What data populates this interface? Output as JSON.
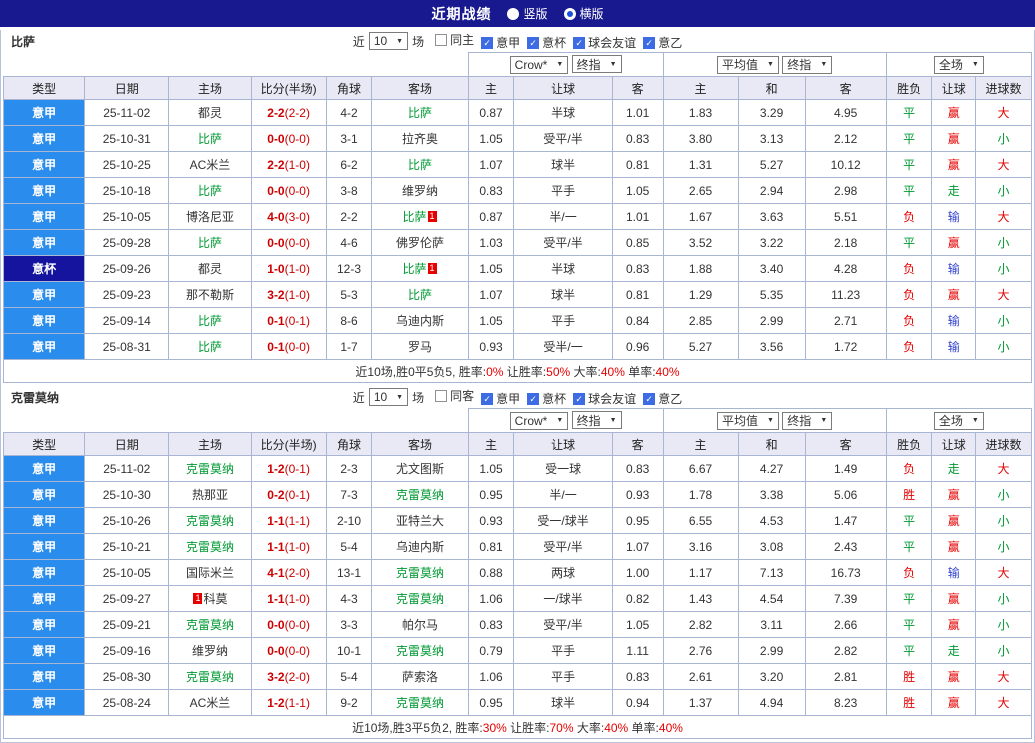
{
  "topbar": {
    "title": "近期战绩",
    "options": [
      {
        "label": "竖版",
        "selected": false
      },
      {
        "label": "横版",
        "selected": true
      }
    ]
  },
  "columns": {
    "type": "类型",
    "date": "日期",
    "home": "主场",
    "score": "比分(半场)",
    "corner": "角球",
    "away": "客场",
    "odds_home": "主",
    "handicap": "让球",
    "odds_away": "客",
    "avg_home": "主",
    "avg_draw": "和",
    "avg_away": "客",
    "result": "胜负",
    "let_result": "让球",
    "goals": "进球数"
  },
  "colors": {
    "accent_blue": "#2a8cec",
    "cup_navy": "#14149e",
    "focus_green": "#009933",
    "score_red": "#cc0000",
    "header_lavender": "#e9e9f6",
    "topbar_navy": "#19198f"
  },
  "value_colors": {
    "胜": "#e60000",
    "平": "#009933",
    "负": "#e60000",
    "赢": "#e60000",
    "走": "#009933",
    "输": "#3344cc",
    "大": "#e60000",
    "小": "#009933"
  },
  "sections": [
    {
      "team": "比萨",
      "filter": {
        "near": "近",
        "count": "10",
        "games": "场",
        "checks": [
          {
            "label": "同主",
            "checked": false
          },
          {
            "label": "意甲",
            "checked": true
          },
          {
            "label": "意杯",
            "checked": true
          },
          {
            "label": "球会友谊",
            "checked": true
          },
          {
            "label": "意乙",
            "checked": true
          }
        ]
      },
      "selects": {
        "odds_source": "Crow*",
        "odds_final": "终指",
        "avg": "平均值",
        "avg_final": "终指",
        "scope": "全场"
      },
      "rows": [
        {
          "league": "意甲",
          "date": "25-11-02",
          "home": "都灵",
          "score": "2-2",
          "half": "(2-2)",
          "corner": "4-2",
          "away": "比萨",
          "o1": "0.87",
          "hc": "半球",
          "o2": "1.01",
          "a1": "1.83",
          "ax": "3.29",
          "a2": "4.95",
          "r": "平",
          "lr": "赢",
          "g": "大"
        },
        {
          "league": "意甲",
          "date": "25-10-31",
          "home": "比萨",
          "score": "0-0",
          "half": "(0-0)",
          "corner": "3-1",
          "away": "拉齐奥",
          "o1": "1.05",
          "hc": "受平/半",
          "o2": "0.83",
          "a1": "3.80",
          "ax": "3.13",
          "a2": "2.12",
          "r": "平",
          "lr": "赢",
          "g": "小"
        },
        {
          "league": "意甲",
          "date": "25-10-25",
          "home": "AC米兰",
          "score": "2-2",
          "half": "(1-0)",
          "corner": "6-2",
          "away": "比萨",
          "o1": "1.07",
          "hc": "球半",
          "o2": "0.81",
          "a1": "1.31",
          "ax": "5.27",
          "a2": "10.12",
          "r": "平",
          "lr": "赢",
          "g": "大"
        },
        {
          "league": "意甲",
          "date": "25-10-18",
          "home": "比萨",
          "score": "0-0",
          "half": "(0-0)",
          "corner": "3-8",
          "away": "维罗纳",
          "o1": "0.83",
          "hc": "平手",
          "o2": "1.05",
          "a1": "2.65",
          "ax": "2.94",
          "a2": "2.98",
          "r": "平",
          "lr": "走",
          "g": "小"
        },
        {
          "league": "意甲",
          "date": "25-10-05",
          "home": "博洛尼亚",
          "score": "4-0",
          "half": "(3-0)",
          "corner": "2-2",
          "away": "比萨",
          "away_card": "1",
          "o1": "0.87",
          "hc": "半/一",
          "o2": "1.01",
          "a1": "1.67",
          "ax": "3.63",
          "a2": "5.51",
          "r": "负",
          "lr": "输",
          "g": "大"
        },
        {
          "league": "意甲",
          "date": "25-09-28",
          "home": "比萨",
          "score": "0-0",
          "half": "(0-0)",
          "corner": "4-6",
          "away": "佛罗伦萨",
          "o1": "1.03",
          "hc": "受平/半",
          "o2": "0.85",
          "a1": "3.52",
          "ax": "3.22",
          "a2": "2.18",
          "r": "平",
          "lr": "赢",
          "g": "小"
        },
        {
          "league": "意杯",
          "date": "25-09-26",
          "home": "都灵",
          "score": "1-0",
          "half": "(1-0)",
          "corner": "12-3",
          "away": "比萨",
          "away_card": "1",
          "o1": "1.05",
          "hc": "半球",
          "o2": "0.83",
          "a1": "1.88",
          "ax": "3.40",
          "a2": "4.28",
          "r": "负",
          "lr": "输",
          "g": "小"
        },
        {
          "league": "意甲",
          "date": "25-09-23",
          "home": "那不勒斯",
          "score": "3-2",
          "half": "(1-0)",
          "corner": "5-3",
          "away": "比萨",
          "o1": "1.07",
          "hc": "球半",
          "o2": "0.81",
          "a1": "1.29",
          "ax": "5.35",
          "a2": "11.23",
          "r": "负",
          "lr": "赢",
          "g": "大"
        },
        {
          "league": "意甲",
          "date": "25-09-14",
          "home": "比萨",
          "score": "0-1",
          "half": "(0-1)",
          "corner": "8-6",
          "away": "乌迪内斯",
          "o1": "1.05",
          "hc": "平手",
          "o2": "0.84",
          "a1": "2.85",
          "ax": "2.99",
          "a2": "2.71",
          "r": "负",
          "lr": "输",
          "g": "小"
        },
        {
          "league": "意甲",
          "date": "25-08-31",
          "home": "比萨",
          "score": "0-1",
          "half": "(0-0)",
          "corner": "1-7",
          "away": "罗马",
          "o1": "0.93",
          "hc": "受半/一",
          "o2": "0.96",
          "a1": "5.27",
          "ax": "3.56",
          "a2": "1.72",
          "r": "负",
          "lr": "输",
          "g": "小"
        }
      ],
      "summary": [
        {
          "text": "近10场,胜0平5负5, 胜率:",
          "red": false
        },
        {
          "text": "0%",
          "red": true
        },
        {
          "text": " 让胜率:",
          "red": false
        },
        {
          "text": "50%",
          "red": true
        },
        {
          "text": " 大率:",
          "red": false
        },
        {
          "text": "40%",
          "red": true
        },
        {
          "text": " 单率:",
          "red": false
        },
        {
          "text": "40%",
          "red": true
        }
      ]
    },
    {
      "team": "克雷莫纳",
      "filter": {
        "near": "近",
        "count": "10",
        "games": "场",
        "checks": [
          {
            "label": "同客",
            "checked": false
          },
          {
            "label": "意甲",
            "checked": true
          },
          {
            "label": "意杯",
            "checked": true
          },
          {
            "label": "球会友谊",
            "checked": true
          },
          {
            "label": "意乙",
            "checked": true
          }
        ]
      },
      "selects": {
        "odds_source": "Crow*",
        "odds_final": "终指",
        "avg": "平均值",
        "avg_final": "终指",
        "scope": "全场"
      },
      "rows": [
        {
          "league": "意甲",
          "date": "25-11-02",
          "home": "克雷莫纳",
          "score": "1-2",
          "half": "(0-1)",
          "corner": "2-3",
          "away": "尤文图斯",
          "o1": "1.05",
          "hc": "受一球",
          "o2": "0.83",
          "a1": "6.67",
          "ax": "4.27",
          "a2": "1.49",
          "r": "负",
          "lr": "走",
          "g": "大"
        },
        {
          "league": "意甲",
          "date": "25-10-30",
          "home": "热那亚",
          "score": "0-2",
          "half": "(0-1)",
          "corner": "7-3",
          "away": "克雷莫纳",
          "o1": "0.95",
          "hc": "半/一",
          "o2": "0.93",
          "a1": "1.78",
          "ax": "3.38",
          "a2": "5.06",
          "r": "胜",
          "lr": "赢",
          "g": "小"
        },
        {
          "league": "意甲",
          "date": "25-10-26",
          "home": "克雷莫纳",
          "score": "1-1",
          "half": "(1-1)",
          "corner": "2-10",
          "away": "亚特兰大",
          "o1": "0.93",
          "hc": "受一/球半",
          "o2": "0.95",
          "a1": "6.55",
          "ax": "4.53",
          "a2": "1.47",
          "r": "平",
          "lr": "赢",
          "g": "小"
        },
        {
          "league": "意甲",
          "date": "25-10-21",
          "home": "克雷莫纳",
          "score": "1-1",
          "half": "(1-0)",
          "corner": "5-4",
          "away": "乌迪内斯",
          "o1": "0.81",
          "hc": "受平/半",
          "o2": "1.07",
          "a1": "3.16",
          "ax": "3.08",
          "a2": "2.43",
          "r": "平",
          "lr": "赢",
          "g": "小"
        },
        {
          "league": "意甲",
          "date": "25-10-05",
          "home": "国际米兰",
          "score": "4-1",
          "half": "(2-0)",
          "corner": "13-1",
          "away": "克雷莫纳",
          "o1": "0.88",
          "hc": "两球",
          "o2": "1.00",
          "a1": "1.17",
          "ax": "7.13",
          "a2": "16.73",
          "r": "负",
          "lr": "输",
          "g": "大"
        },
        {
          "league": "意甲",
          "date": "25-09-27",
          "home": "科莫",
          "home_card_pre": "1",
          "score": "1-1",
          "half": "(1-0)",
          "corner": "4-3",
          "away": "克雷莫纳",
          "o1": "1.06",
          "hc": "一/球半",
          "o2": "0.82",
          "a1": "1.43",
          "ax": "4.54",
          "a2": "7.39",
          "r": "平",
          "lr": "赢",
          "g": "小"
        },
        {
          "league": "意甲",
          "date": "25-09-21",
          "home": "克雷莫纳",
          "score": "0-0",
          "half": "(0-0)",
          "corner": "3-3",
          "away": "帕尔马",
          "o1": "0.83",
          "hc": "受平/半",
          "o2": "1.05",
          "a1": "2.82",
          "ax": "3.11",
          "a2": "2.66",
          "r": "平",
          "lr": "赢",
          "g": "小"
        },
        {
          "league": "意甲",
          "date": "25-09-16",
          "home": "维罗纳",
          "score": "0-0",
          "half": "(0-0)",
          "corner": "10-1",
          "away": "克雷莫纳",
          "o1": "0.79",
          "hc": "平手",
          "o2": "1.11",
          "a1": "2.76",
          "ax": "2.99",
          "a2": "2.82",
          "r": "平",
          "lr": "走",
          "g": "小"
        },
        {
          "league": "意甲",
          "date": "25-08-30",
          "home": "克雷莫纳",
          "score": "3-2",
          "half": "(2-0)",
          "corner": "5-4",
          "away": "萨索洛",
          "o1": "1.06",
          "hc": "平手",
          "o2": "0.83",
          "a1": "2.61",
          "ax": "3.20",
          "a2": "2.81",
          "r": "胜",
          "lr": "赢",
          "g": "大"
        },
        {
          "league": "意甲",
          "date": "25-08-24",
          "home": "AC米兰",
          "score": "1-2",
          "half": "(1-1)",
          "corner": "9-2",
          "away": "克雷莫纳",
          "o1": "0.95",
          "hc": "球半",
          "o2": "0.94",
          "a1": "1.37",
          "ax": "4.94",
          "a2": "8.23",
          "r": "胜",
          "lr": "赢",
          "g": "大"
        }
      ],
      "summary": [
        {
          "text": "近10场,胜3平5负2, 胜率:",
          "red": false
        },
        {
          "text": "30%",
          "red": true
        },
        {
          "text": " 让胜率:",
          "red": false
        },
        {
          "text": "70%",
          "red": true
        },
        {
          "text": " 大率:",
          "red": false
        },
        {
          "text": "40%",
          "red": true
        },
        {
          "text": " 单率:",
          "red": false
        },
        {
          "text": "40%",
          "red": true
        }
      ]
    }
  ]
}
